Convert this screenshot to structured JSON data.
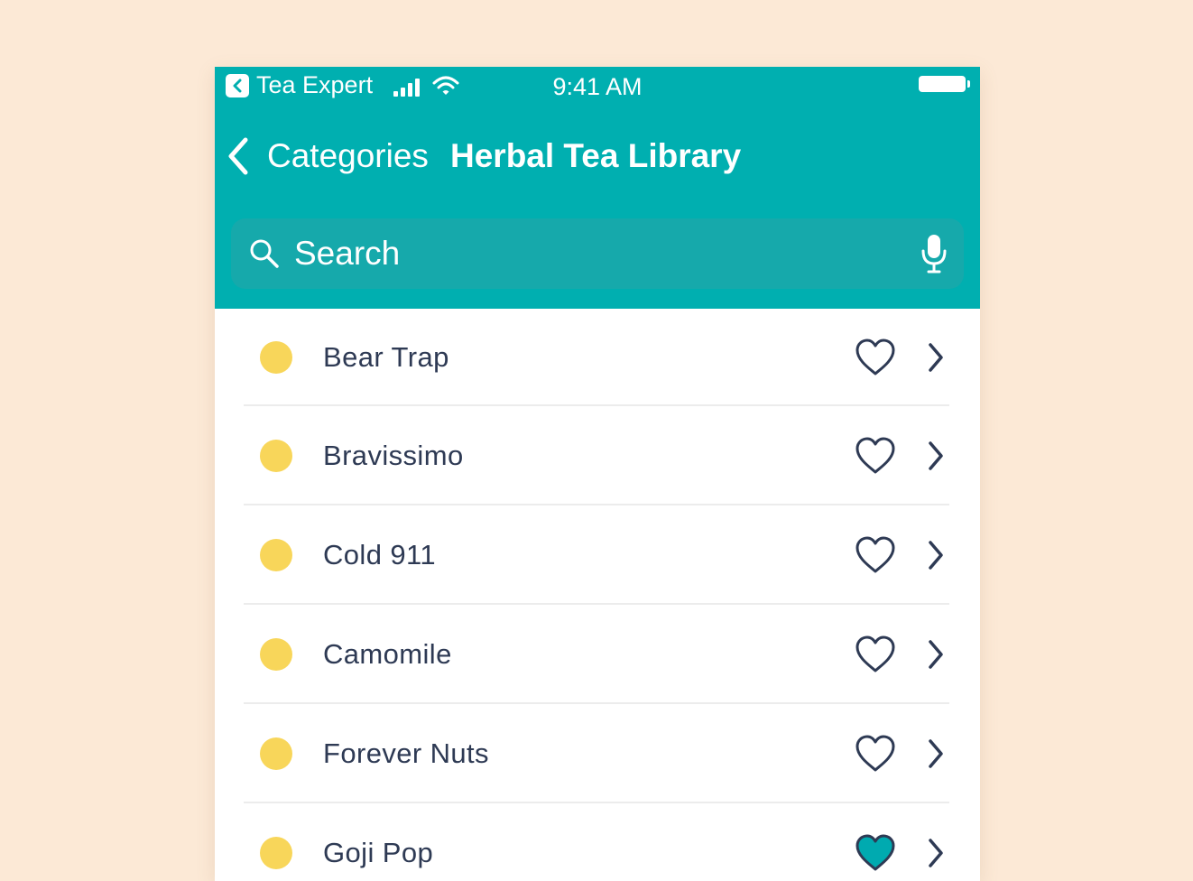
{
  "status_bar": {
    "app_name": "Tea Expert",
    "time": "9:41 AM",
    "icons": [
      "back-to-app-icon",
      "cellular-signal-icon",
      "wifi-icon",
      "battery-icon"
    ]
  },
  "nav": {
    "back_label": "Categories",
    "title": "Herbal Tea Library"
  },
  "search": {
    "placeholder": "Search"
  },
  "colors": {
    "header": "#00afb0",
    "search_bar": "#16a9ab",
    "dot": "#f8d65a",
    "text": "#2e3a54",
    "favorite_fill": "#00aab0",
    "background": "#fce9d6"
  },
  "teas": [
    {
      "name": "Bear Trap",
      "favorite": false
    },
    {
      "name": "Bravissimo",
      "favorite": false
    },
    {
      "name": "Cold 911",
      "favorite": false
    },
    {
      "name": "Camomile",
      "favorite": false
    },
    {
      "name": "Forever Nuts",
      "favorite": false
    },
    {
      "name": "Goji Pop",
      "favorite": true
    }
  ]
}
